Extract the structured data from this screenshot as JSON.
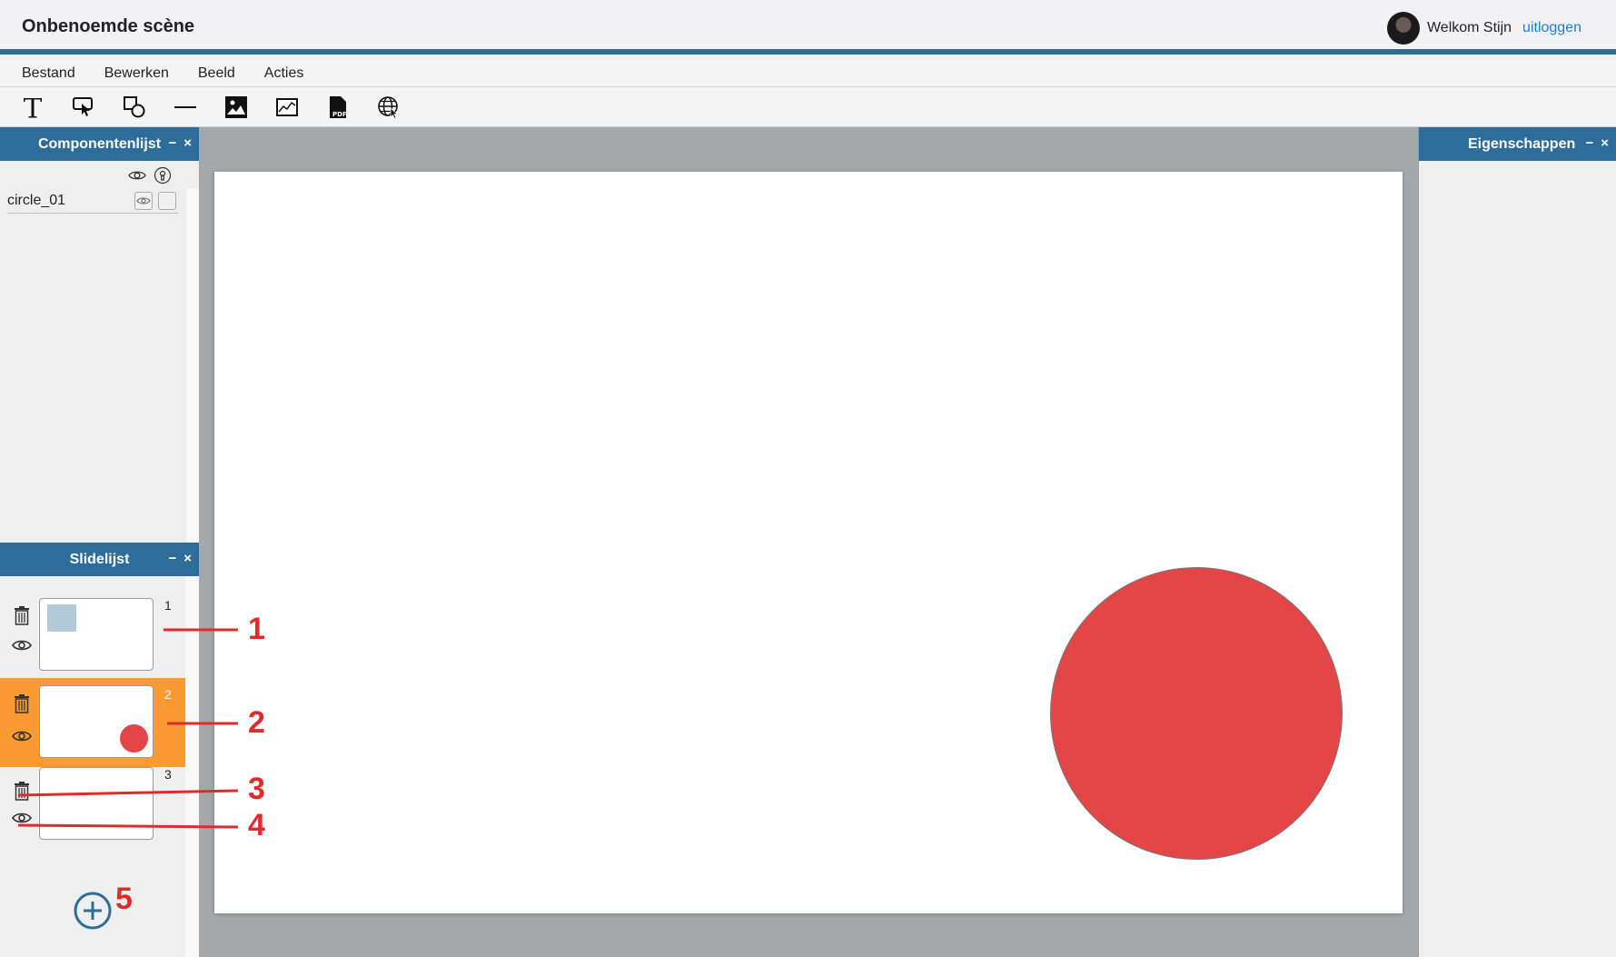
{
  "app": {
    "title": "Onbenoemde scène"
  },
  "user": {
    "welcome_text": "Welkom Stijn",
    "logout_label": "uitloggen"
  },
  "menu": {
    "items": [
      "Bestand",
      "Bewerken",
      "Beeld",
      "Acties"
    ]
  },
  "toolbar": {
    "tools": [
      "text-tool-icon",
      "button-tool-icon",
      "shape-tool-icon",
      "line-tool-icon",
      "image-tool-icon",
      "chart-tool-icon",
      "pdf-tool-icon",
      "web-tool-icon"
    ]
  },
  "component_panel": {
    "title": "Componentenlijst",
    "minimize_label": "−",
    "close_label": "×",
    "components": [
      {
        "name": "circle_01"
      }
    ]
  },
  "slide_panel": {
    "title": "Slidelijst",
    "minimize_label": "−",
    "close_label": "×",
    "slides": [
      {
        "number": "1",
        "active": false,
        "content": "square"
      },
      {
        "number": "2",
        "active": true,
        "content": "circle"
      },
      {
        "number": "3",
        "active": false,
        "content": "empty"
      }
    ]
  },
  "properties_panel": {
    "title": "Eigenschappen",
    "minimize_label": "−",
    "close_label": "×"
  },
  "stage": {
    "shapes": [
      {
        "name": "circle_01",
        "type": "circle",
        "color": "#e44547"
      }
    ]
  },
  "annotations": {
    "color": "#e02b2b",
    "labels": [
      "1",
      "2",
      "3",
      "4",
      "5"
    ]
  },
  "colors": {
    "accent": "#2e6d99",
    "active_slide": "#fb9a30",
    "link": "#1a7fd0",
    "canvas_bg": "#a4a8ab"
  }
}
